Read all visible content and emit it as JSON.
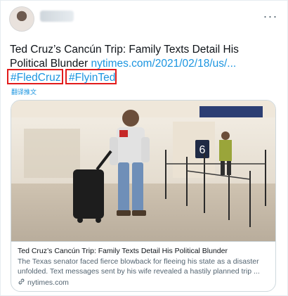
{
  "header": {
    "more_label": "···"
  },
  "tweet": {
    "text_plain": "Ted Cruz’s Cancún Trip: Family Texts Detail His Political Blunder ",
    "text_link": "nytimes.com/2021/02/18/us/...",
    "hashtags": [
      "#FledCruz",
      "#FlyinTed"
    ],
    "translate_label": "翻译推文"
  },
  "card": {
    "title": "Ted Cruz’s Cancún Trip: Family Texts Detail His Political Blunder",
    "description": "The Texas senator faced fierce blowback for fleeing his state as a disaster unfolded. Text messages sent by his wife revealed a hastily planned trip ...",
    "domain": "nytimes.com",
    "photo_sign": "6"
  },
  "colors": {
    "link": "#1b95e0",
    "highlight_box": "#e21b1b",
    "muted": "#536471",
    "border": "#cfd9de"
  }
}
